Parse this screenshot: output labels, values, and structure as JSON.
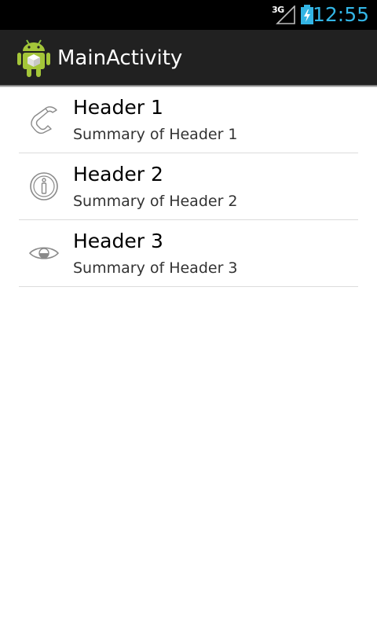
{
  "status_bar": {
    "network": "3G",
    "signal_icon": "signal-icon",
    "battery_icon": "battery-charging-icon",
    "time": "12:55",
    "time_color": "#33b5e5"
  },
  "action_bar": {
    "app_icon": "android-robot-icon",
    "title": "MainActivity"
  },
  "headers": [
    {
      "title": "Header 1",
      "summary": "Summary of Header 1",
      "icon": "phone-icon"
    },
    {
      "title": "Header 2",
      "summary": "Summary of Header 2",
      "icon": "info-icon"
    },
    {
      "title": "Header 3",
      "summary": "Summary of Header 3",
      "icon": "eye-icon"
    }
  ]
}
